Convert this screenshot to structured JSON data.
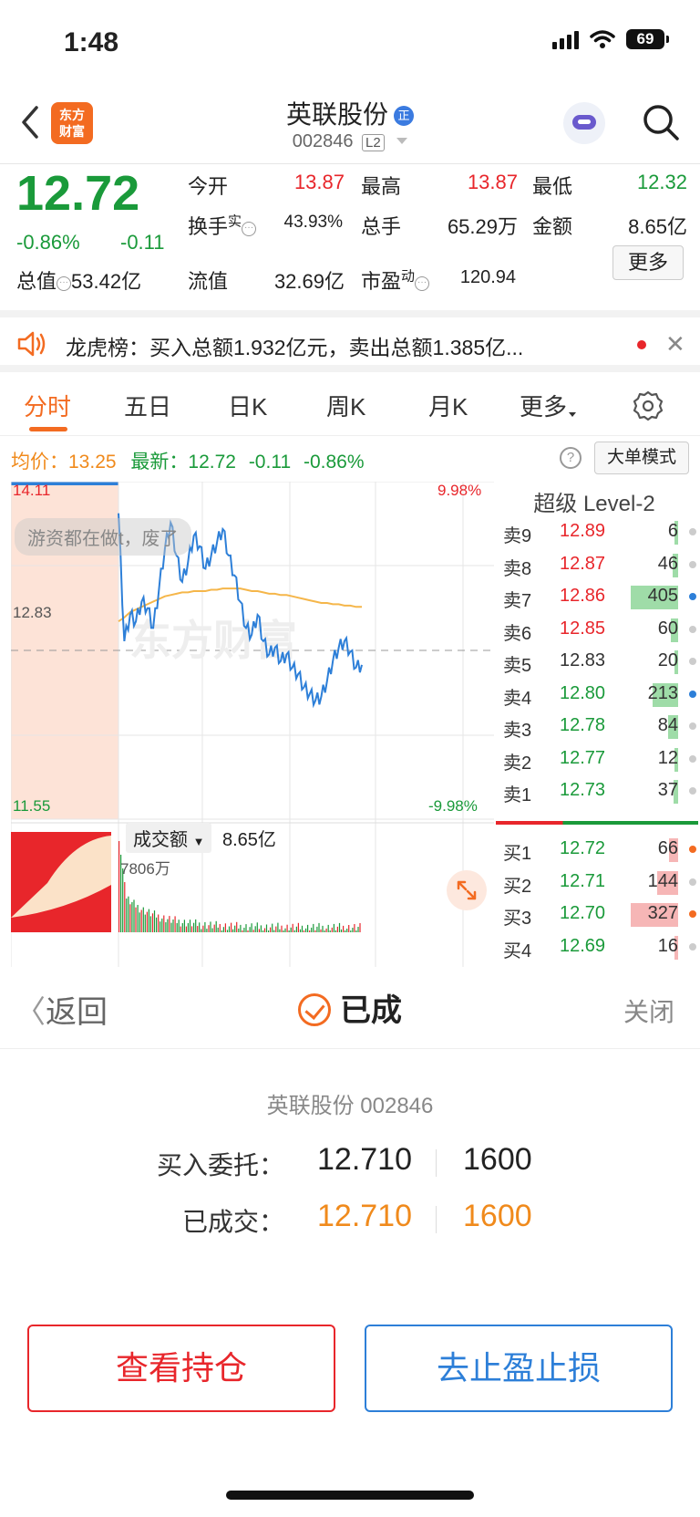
{
  "status": {
    "time": "1:48",
    "battery": "69"
  },
  "header": {
    "stock_name": "英联股份",
    "badge": "正",
    "stock_code": "002846",
    "level_tag": "L2",
    "logo_line1": "东方",
    "logo_line2": "财富"
  },
  "quote": {
    "last_price": "12.72",
    "change_pct": "-0.86%",
    "change_amt": "-0.11",
    "open_label": "今开",
    "open": "13.87",
    "high_label": "最高",
    "high": "13.87",
    "low_label": "最低",
    "low": "12.32",
    "turnover_label": "换手",
    "turnover_sup": "实",
    "turnover": "43.93%",
    "volume_label": "总手",
    "volume": "65.29万",
    "amount_label": "金额",
    "amount": "8.65亿",
    "mktcap_label": "总值",
    "mktcap": "53.42亿",
    "float_label": "流值",
    "float_cap": "32.69亿",
    "pe_label": "市盈",
    "pe_sup": "动",
    "pe": "120.94",
    "more_label": "更多"
  },
  "dragon_tiger": {
    "text": "龙虎榜：买入总额1.932亿元，卖出总额1.385亿..."
  },
  "tabs": [
    "分时",
    "五日",
    "日K",
    "周K",
    "月K",
    "更多"
  ],
  "chart_head": {
    "avg_label": "均价：",
    "avg_value": "13.25",
    "latest_label": "最新：",
    "latest_value": "12.72",
    "latest_chg": "-0.11",
    "latest_pct": "-0.86%",
    "big_order_label": "大单模式"
  },
  "chart_labels": {
    "y_top": "14.11",
    "y_mid": "12.83",
    "y_bottom": "11.55",
    "pct_top": "9.98%",
    "pct_bottom": "-9.98%",
    "comment": "游资都在做t，废了",
    "vol_label": "成交额",
    "vol_total": "8.65亿",
    "vol_max": "7806万",
    "watermark": "东方财富"
  },
  "chart_data": {
    "type": "line",
    "ylim": [
      11.55,
      14.11
    ],
    "series": [
      {
        "values": [
          13.87,
          12.9,
          13.1,
          13.05,
          13.2,
          13.15,
          13.0,
          13.3,
          13.6,
          13.8,
          13.55,
          13.35,
          13.5,
          13.7,
          13.62,
          13.45,
          13.55,
          13.65,
          13.75,
          13.55,
          13.4,
          13.2,
          13.0,
          12.95,
          13.1,
          12.9,
          12.8,
          12.85,
          12.75,
          12.8,
          12.7,
          12.65,
          12.55,
          12.5,
          12.45,
          12.48,
          12.6,
          12.75,
          12.85,
          12.9,
          12.82,
          12.7,
          12.72
        ]
      },
      {
        "values": [
          13.05,
          13.08,
          13.12,
          13.14,
          13.16,
          13.18,
          13.2,
          13.22,
          13.24,
          13.25,
          13.26,
          13.27,
          13.27,
          13.28,
          13.28,
          13.28,
          13.29,
          13.29,
          13.3,
          13.3,
          13.3,
          13.3,
          13.29,
          13.28,
          13.28,
          13.27,
          13.26,
          13.26,
          13.25,
          13.25,
          13.24,
          13.23,
          13.22,
          13.21,
          13.2,
          13.19,
          13.19,
          13.18,
          13.18,
          13.17,
          13.17,
          13.16,
          13.16
        ]
      }
    ]
  },
  "order_book": {
    "title": "超级 Level-2",
    "asks": [
      {
        "label": "卖9",
        "price": "12.89",
        "volume": "6",
        "bar": 0.01,
        "dot": "#cccccc"
      },
      {
        "label": "卖8",
        "price": "12.87",
        "volume": "46",
        "bar": 0.11,
        "dot": "#cccccc"
      },
      {
        "label": "卖7",
        "price": "12.86",
        "volume": "405",
        "bar": 1.0,
        "dot": "#2d7fd8"
      },
      {
        "label": "卖6",
        "price": "12.85",
        "volume": "60",
        "bar": 0.15,
        "dot": "#cccccc"
      },
      {
        "label": "卖5",
        "price": "12.83",
        "volume": "20",
        "bar": 0.05,
        "dot": "#cccccc"
      },
      {
        "label": "卖4",
        "price": "12.80",
        "volume": "213",
        "bar": 0.53,
        "dot": "#2d7fd8"
      },
      {
        "label": "卖3",
        "price": "12.78",
        "volume": "84",
        "bar": 0.21,
        "dot": "#cccccc"
      },
      {
        "label": "卖2",
        "price": "12.77",
        "volume": "12",
        "bar": 0.03,
        "dot": "#cccccc"
      },
      {
        "label": "卖1",
        "price": "12.73",
        "volume": "37",
        "bar": 0.09,
        "dot": "#cccccc"
      }
    ],
    "bids": [
      {
        "label": "买1",
        "price": "12.72",
        "volume": "66",
        "bar": 0.2,
        "dot": "#f36b21"
      },
      {
        "label": "买2",
        "price": "12.71",
        "volume": "144",
        "bar": 0.44,
        "dot": "#cccccc"
      },
      {
        "label": "买3",
        "price": "12.70",
        "volume": "327",
        "bar": 1.0,
        "dot": "#f36b21"
      },
      {
        "label": "买4",
        "price": "12.69",
        "volume": "16",
        "bar": 0.05,
        "dot": "#cccccc"
      }
    ]
  },
  "sheet": {
    "back_label": "返回",
    "title": "已成",
    "close_label": "关闭",
    "subtitle": "英联股份 002846",
    "entrust_label": "买入委托：",
    "entrust_price": "12.710",
    "entrust_qty": "1600",
    "filled_label": "已成交：",
    "filled_price": "12.710",
    "filled_qty": "1600",
    "btn_positions": "查看持仓",
    "btn_stop": "去止盈止损"
  },
  "colors": {
    "red": "#e8262b",
    "green": "#1a9a3a",
    "orange": "#f36b21",
    "blue": "#2d7fd8"
  }
}
